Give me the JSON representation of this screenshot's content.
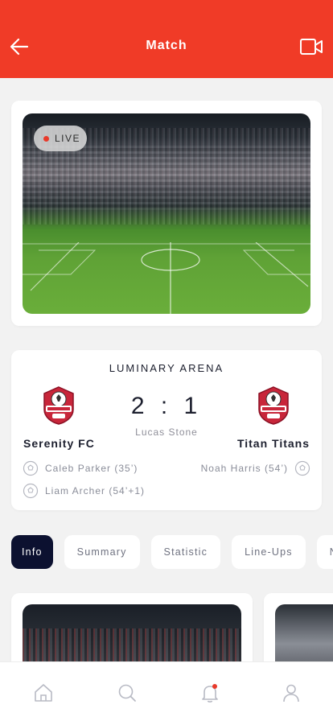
{
  "theme": {
    "accent": "#f03b27",
    "tab_active_bg": "#0c1130",
    "live_dot": "#e8392a"
  },
  "header": {
    "title": "Match",
    "back_icon": "arrow-left-icon",
    "video_icon": "video-camera-icon"
  },
  "stream": {
    "live_label": "LIVE"
  },
  "match": {
    "venue": "LUMINARY ARENA",
    "score": "2 : 1",
    "referee": "Lucas Stone",
    "home": {
      "name": "Serenity FC",
      "scorers": [
        "Caleb Parker (35’)",
        "Liam Archer (54’+1)"
      ]
    },
    "away": {
      "name": "Titan Titans",
      "scorers": [
        "Noah Harris (54’)"
      ]
    }
  },
  "tabs": [
    {
      "label": "Info",
      "active": true
    },
    {
      "label": "Summary",
      "active": false
    },
    {
      "label": "Statistic",
      "active": false
    },
    {
      "label": "Line-Ups",
      "active": false
    },
    {
      "label": "Ne",
      "active": false
    }
  ],
  "bottom_nav": {
    "items": [
      "home-icon",
      "search-icon",
      "bell-icon",
      "profile-icon"
    ]
  }
}
